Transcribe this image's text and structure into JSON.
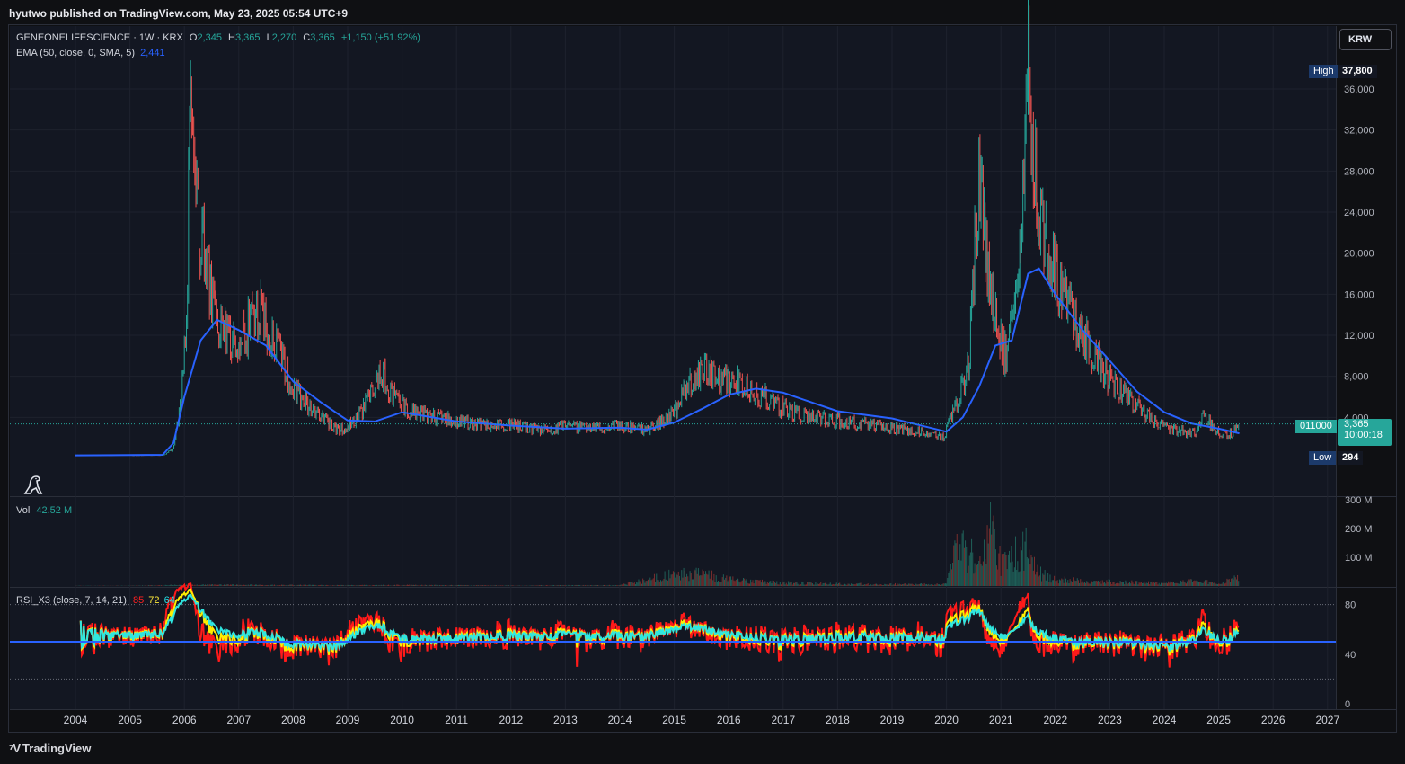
{
  "header": {
    "published_text": "hyutwo published on TradingView.com, May 23, 2025 05:54 UTC+9"
  },
  "currency_button": {
    "label": "KRW"
  },
  "legend": {
    "symbol": "GENEONELIFESCIENCE · 1W · KRX",
    "o_label": "O",
    "o_value": "2,345",
    "h_label": "H",
    "h_value": "3,365",
    "l_label": "L",
    "l_value": "2,270",
    "c_label": "C",
    "c_value": "3,365",
    "change": "+1,150 (+51.92%)",
    "ema_label": "EMA (50, close, 0, SMA, 5)",
    "ema_value": "2,441",
    "vol_label": "Vol",
    "vol_value": "42.52 M",
    "rsi_label": "RSI_X3 (close, 7, 14, 21)",
    "rsi_v1": "85",
    "rsi_v2": "72",
    "rsi_v3": "64"
  },
  "tags": {
    "high_label": "High",
    "high_value": "37,800",
    "low_label": "Low",
    "low_value": "294",
    "symbol_code": "011000",
    "last_price": "3,365",
    "countdown": "10:00:18"
  },
  "colors": {
    "up": "#26a69a",
    "down": "#ef5350",
    "ema": "#2962ff",
    "background": "#131722",
    "rsi1": "#ff1a1a",
    "rsi2": "#ffee00",
    "rsi3": "#2fe6e0"
  },
  "footer": {
    "brand": "TradingView",
    "brand_icon": "tradingview-logo-icon"
  },
  "chart_data": [
    {
      "type": "line",
      "title": "GENEONELIFESCIENCE · 1W · KRX",
      "ylim": [
        0,
        38000
      ],
      "y_ticks": [
        "4,000",
        "8,000",
        "12,000",
        "16,000",
        "20,000",
        "24,000",
        "28,000",
        "32,000",
        "36,000"
      ],
      "x_ticks": [
        "2004",
        "2005",
        "2006",
        "2007",
        "2008",
        "2009",
        "2010",
        "2011",
        "2012",
        "2013",
        "2014",
        "2015",
        "2016",
        "2017",
        "2018",
        "2019",
        "2020",
        "2021",
        "2022",
        "2023",
        "2024",
        "2025",
        "2026",
        "2027"
      ],
      "series": [
        {
          "name": "GENEONELIFESCIENCE",
          "x": [
            2004.0,
            2004.9,
            2005.6,
            2005.8,
            2005.95,
            2006.05,
            2006.1,
            2006.2,
            2006.4,
            2006.6,
            2006.9,
            2007.2,
            2007.4,
            2007.6,
            2008.0,
            2008.4,
            2008.8,
            2009.0,
            2009.3,
            2009.6,
            2009.9,
            2010.3,
            2010.8,
            2011.2,
            2011.6,
            2012.0,
            2012.5,
            2013.0,
            2013.5,
            2014.0,
            2014.5,
            2015.0,
            2015.2,
            2015.5,
            2015.8,
            2016.0,
            2016.3,
            2016.6,
            2017.0,
            2017.5,
            2018.0,
            2018.5,
            2019.0,
            2019.5,
            2019.95,
            2020.2,
            2020.4,
            2020.6,
            2020.75,
            2020.9,
            2021.1,
            2021.3,
            2021.5,
            2021.55,
            2021.7,
            2021.9,
            2022.1,
            2022.4,
            2022.7,
            2023.0,
            2023.3,
            2023.6,
            2024.0,
            2024.4,
            2024.6,
            2024.7,
            2025.0,
            2025.2,
            2025.38
          ],
          "values": [
            300,
            300,
            310,
            900,
            6000,
            16000,
            33000,
            24000,
            19000,
            13000,
            11000,
            13000,
            14000,
            12000,
            6500,
            4500,
            2800,
            3000,
            4800,
            8500,
            5500,
            4200,
            3800,
            3500,
            3200,
            3300,
            2800,
            3000,
            2900,
            3200,
            2700,
            4500,
            6500,
            8500,
            8000,
            7500,
            7200,
            6000,
            4800,
            4000,
            3600,
            3300,
            2900,
            2600,
            2000,
            5500,
            9000,
            27000,
            19000,
            14000,
            9500,
            16000,
            36000,
            30000,
            24000,
            20000,
            16000,
            13000,
            10000,
            7500,
            6000,
            4500,
            3000,
            2500,
            2400,
            4200,
            2500,
            2300,
            3365
          ]
        },
        {
          "name": "EMA (50, close, 0, SMA, 5)",
          "x": [
            2004.0,
            2005.6,
            2005.8,
            2006.0,
            2006.3,
            2006.6,
            2007.0,
            2007.5,
            2008.0,
            2008.5,
            2009.0,
            2009.5,
            2010.0,
            2011.0,
            2012.0,
            2013.0,
            2014.0,
            2014.5,
            2015.0,
            2015.5,
            2016.0,
            2016.5,
            2017.0,
            2017.5,
            2018.0,
            2019.0,
            2020.0,
            2020.3,
            2020.6,
            2020.9,
            2021.2,
            2021.5,
            2021.7,
            2022.0,
            2022.5,
            2023.0,
            2023.5,
            2024.0,
            2024.5,
            2025.0,
            2025.38
          ],
          "values": [
            300,
            350,
            1500,
            6000,
            11500,
            13500,
            12500,
            11000,
            7500,
            5500,
            3700,
            3600,
            4500,
            3600,
            3200,
            2900,
            3000,
            2800,
            3500,
            4800,
            6200,
            6800,
            6400,
            5500,
            4600,
            3900,
            2600,
            4000,
            7000,
            11000,
            11500,
            18000,
            18500,
            16000,
            12500,
            9500,
            6500,
            4500,
            3400,
            2900,
            2441
          ]
        },
        {
          "name": "Vol",
          "unit": "M",
          "ylim": [
            0,
            300
          ],
          "y_ticks": [
            "100 M",
            "200 M",
            "300 M"
          ],
          "x": [
            2004.0,
            2005.0,
            2006.0,
            2007.0,
            2008.0,
            2009.0,
            2010.0,
            2011.0,
            2012.0,
            2013.0,
            2014.0,
            2014.8,
            2015.4,
            2016.0,
            2016.5,
            2017.0,
            2018.0,
            2019.0,
            2020.0,
            2020.2,
            2020.6,
            2020.8,
            2021.0,
            2021.3,
            2021.5,
            2021.7,
            2022.0,
            2023.0,
            2024.0,
            2024.6,
            2025.0,
            2025.38
          ],
          "values": [
            1,
            1,
            5,
            5,
            4,
            3,
            4,
            3,
            2,
            3,
            3,
            45,
            60,
            30,
            20,
            15,
            10,
            8,
            8,
            180,
            120,
            260,
            100,
            150,
            180,
            60,
            30,
            20,
            12,
            25,
            10,
            42.52
          ]
        },
        {
          "name": "RSI_X3 (close, 7, 14, 21)",
          "ylim": [
            0,
            100
          ],
          "y_ticks": [
            "0",
            "40",
            "80"
          ]
        }
      ]
    }
  ]
}
